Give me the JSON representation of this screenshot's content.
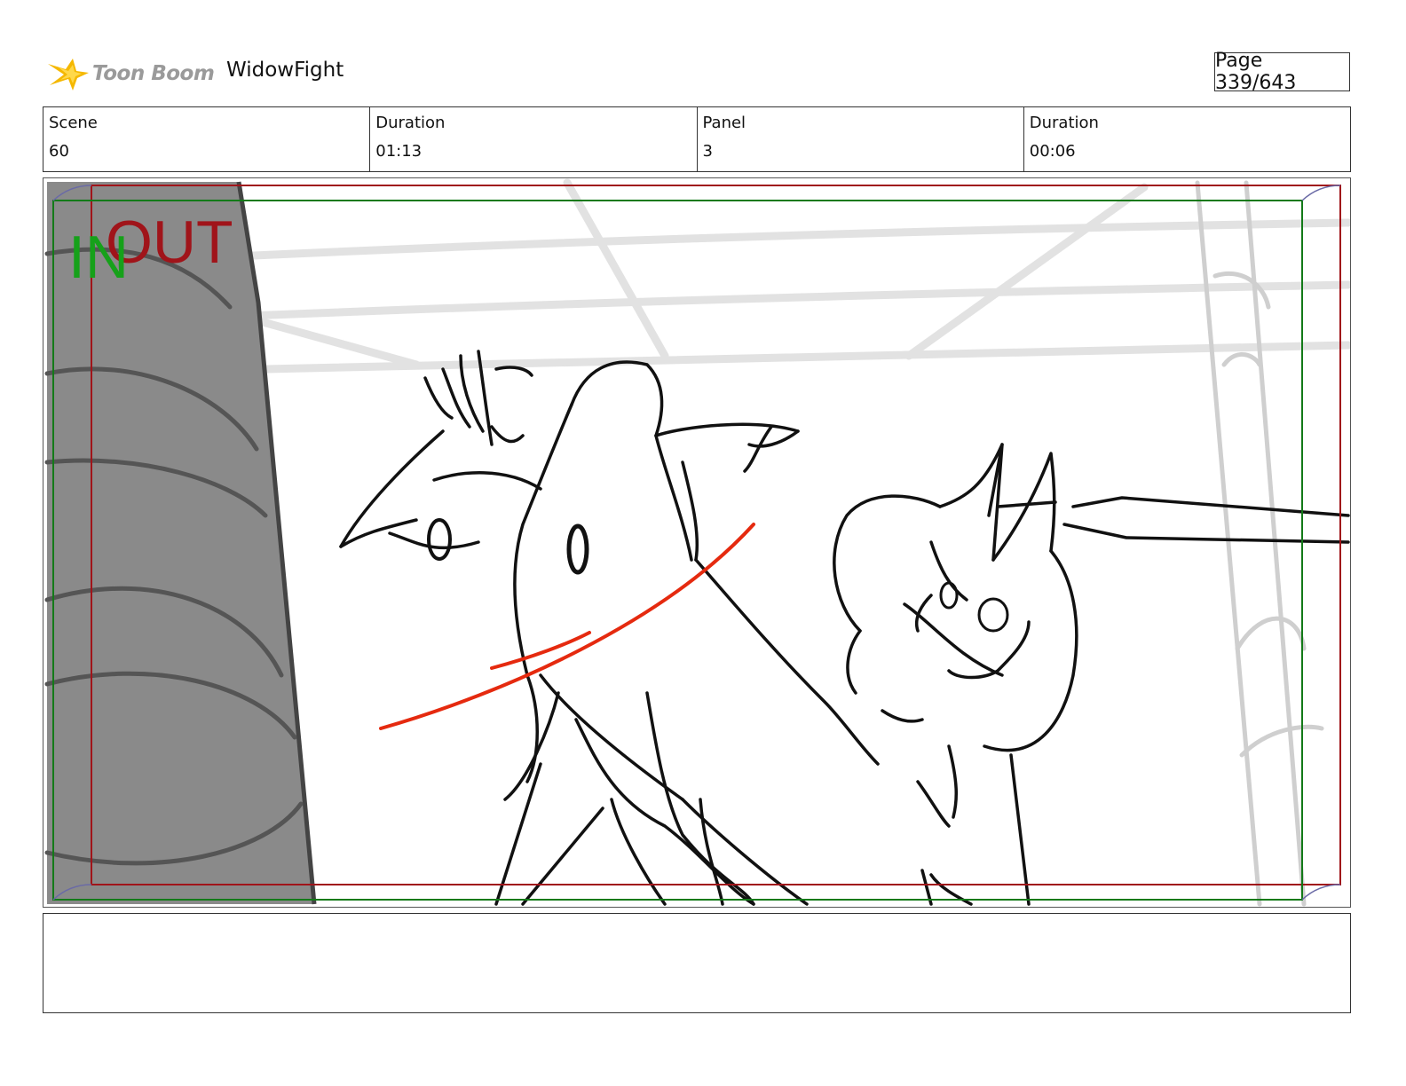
{
  "header": {
    "logo_text": "Toon Boom",
    "project_name": "WidowFight",
    "page_label": "Page 339/643"
  },
  "info": [
    {
      "label": "Scene",
      "value": "60"
    },
    {
      "label": "Duration",
      "value": "01:13"
    },
    {
      "label": "Panel",
      "value": "3"
    },
    {
      "label": "Duration",
      "value": "00:06"
    }
  ],
  "panel": {
    "in_label": "IN",
    "out_label": "OUT",
    "in_color": "#16a11a",
    "out_color": "#a0141a"
  },
  "notes": {
    "text": ""
  }
}
